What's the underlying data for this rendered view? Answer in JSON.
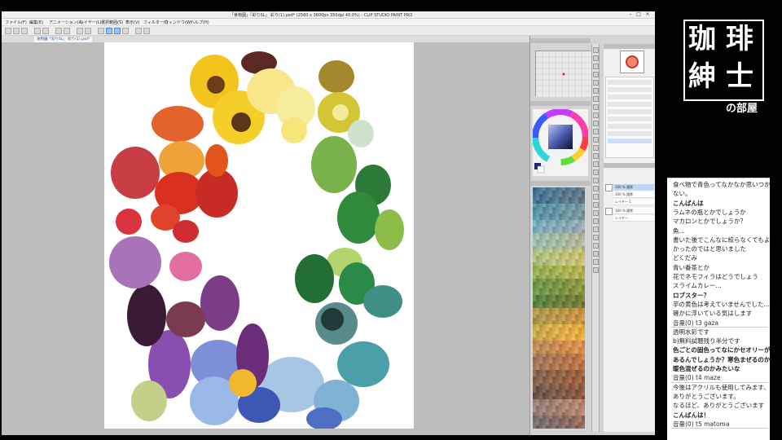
{
  "app": {
    "title": "「食物園」「彩りSL」 彩り(1).psd* (2560 x 3600px 350dpi 40.0%) - CLIP STUDIO PAINT PRO",
    "menu": [
      "ファイル(F)",
      "編集(E)",
      "アニメーション(A)",
      "レイヤー(L)",
      "選択範囲(S)",
      "表示(V)",
      "フィルター(I)",
      "ウィンドウ(W)",
      "ヘルプ(H)"
    ],
    "tab_label": "食物園「彩りSL」 彩り(1).psd*"
  },
  "colors": {
    "accent": "#4d8ed0",
    "canvas_bg": "#bdbdbd",
    "panel_bg": "#d4d4d4"
  },
  "layers": [
    {
      "label": "100 % 通常"
    },
    {
      "label": "100 % 通常"
    },
    {
      "label": "レイヤー 1"
    },
    {
      "label": "100 % 通常"
    },
    {
      "label": "レイヤー"
    }
  ],
  "logo": {
    "kanji": [
      "珈",
      "琲",
      "紳",
      "士"
    ],
    "subtitle": "の部屋"
  },
  "chat": {
    "lines": [
      {
        "t": "食べ物で青色ってなかなか思いつか",
        "bold": false
      },
      {
        "t": "ない。",
        "bold": false
      },
      {
        "t": "こんばんは",
        "bold": true
      },
      {
        "t": "ラムネの瓶とかでしょうか",
        "bold": false
      },
      {
        "t": "マカロンとかでしょうか？",
        "bold": false
      },
      {
        "t": "魚…",
        "bold": false
      },
      {
        "t": "書いた後でこんなに絞らなくてもよ",
        "bold": false
      },
      {
        "t": "かったのではと思いました",
        "bold": false
      },
      {
        "t": "どくだみ",
        "bold": false
      },
      {
        "t": "青い番茶とか",
        "bold": false
      },
      {
        "t": "花でネモフィラはどうでしょう",
        "bold": false
      },
      {
        "t": "スライムカレー…",
        "bold": false
      },
      {
        "t": "ロブスター？",
        "bold": true
      },
      {
        "t": "芋の黄色は考えていませんでした…",
        "bold": false
      },
      {
        "t": "確かに浮いている気はします",
        "bold": false
      },
      {
        "t": "音量(0)   t3 gaza",
        "bold": false,
        "meta": true
      },
      {
        "t": "透明水彩です",
        "bold": false
      },
      {
        "t": "b)無料試聴残り半分です",
        "bold": false
      },
      {
        "t": "色ごとの固色ってなにかセオリーが",
        "bold": true
      },
      {
        "t": "あるんでしょうか？寒色まぜるのか",
        "bold": true
      },
      {
        "t": "暖色混ぜるのかみたいな",
        "bold": true
      },
      {
        "t": "音量(0)   t4 maze",
        "bold": false,
        "meta": true
      },
      {
        "t": "今後はアクリルも使用してみます、",
        "bold": false
      },
      {
        "t": "ありがとうございます。",
        "bold": false
      },
      {
        "t": "なるほど、ありがとうございます",
        "bold": false
      },
      {
        "t": "こんばんは！",
        "bold": true
      },
      {
        "t": "音量(0)   t5 matoma",
        "bold": false,
        "meta": true
      }
    ]
  }
}
